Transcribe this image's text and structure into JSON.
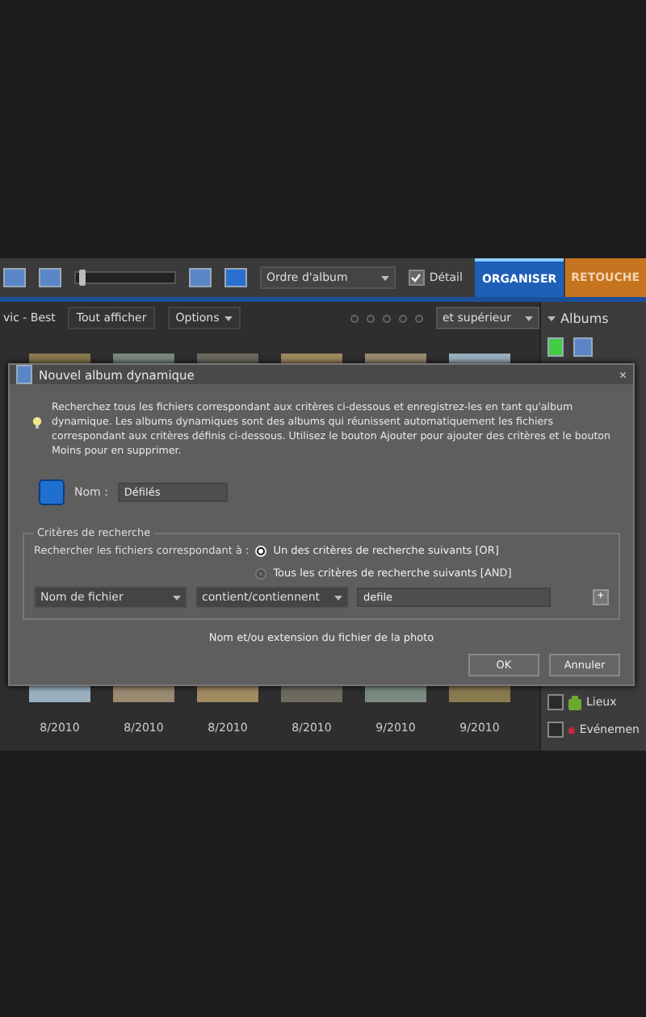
{
  "toolbar": {
    "zoom": {
      "level": 0.03
    },
    "sort": "Ordre d'album",
    "detail": {
      "label": "Détail",
      "checked": true
    },
    "tabs": [
      {
        "label": "ORGANISER",
        "selected": true,
        "color": "#1f5fb8"
      },
      {
        "label": "RETOUCHE",
        "selected": false,
        "color": "#c77420"
      }
    ]
  },
  "filter_bar": {
    "catalog": "vic - Best",
    "show_all": "Tout afficher",
    "options": "Options",
    "stars": 0,
    "rating": "et supérieur"
  },
  "albums_panel": {
    "title": "Albums",
    "items": [
      {
        "label": "Lieux",
        "checked": false,
        "color": "#6aa832"
      },
      {
        "label": "Evénemen",
        "checked": false,
        "color": "#c0283a"
      }
    ]
  },
  "thumbnails": [
    {
      "date": "8/2010"
    },
    {
      "date": "8/2010"
    },
    {
      "date": "8/2010"
    },
    {
      "date": "8/2010"
    },
    {
      "date": "9/2010"
    },
    {
      "date": "9/2010"
    }
  ],
  "dialog": {
    "title": "Nouvel album dynamique",
    "close": "×",
    "info": "Recherchez tous les fichiers correspondant aux critères ci-dessous et enregistrez-les en tant qu'album dynamique. Les albums dynamiques sont des albums qui réunissent automatiquement les fichiers correspondant aux critères définis ci-dessous. Utilisez le bouton Ajouter pour ajouter des critères et le bouton Moins pour en supprimer.",
    "name_label": "Nom :",
    "name_value": "Défilés",
    "criteria": {
      "legend": "Critères de recherche",
      "match_label": "Rechercher les fichiers correspondant à :",
      "options": [
        {
          "label": "Un des critères de recherche suivants [OR]",
          "selected": true
        },
        {
          "label": "Tous les critères de recherche suivants [AND]",
          "selected": false
        }
      ],
      "rule": {
        "field": "Nom de fichier",
        "operator": "contient/contiennent",
        "value": "defile",
        "add": "+"
      }
    },
    "hint": "Nom et/ou extension du fichier de la photo",
    "buttons": [
      "OK",
      "Annuler"
    ]
  }
}
